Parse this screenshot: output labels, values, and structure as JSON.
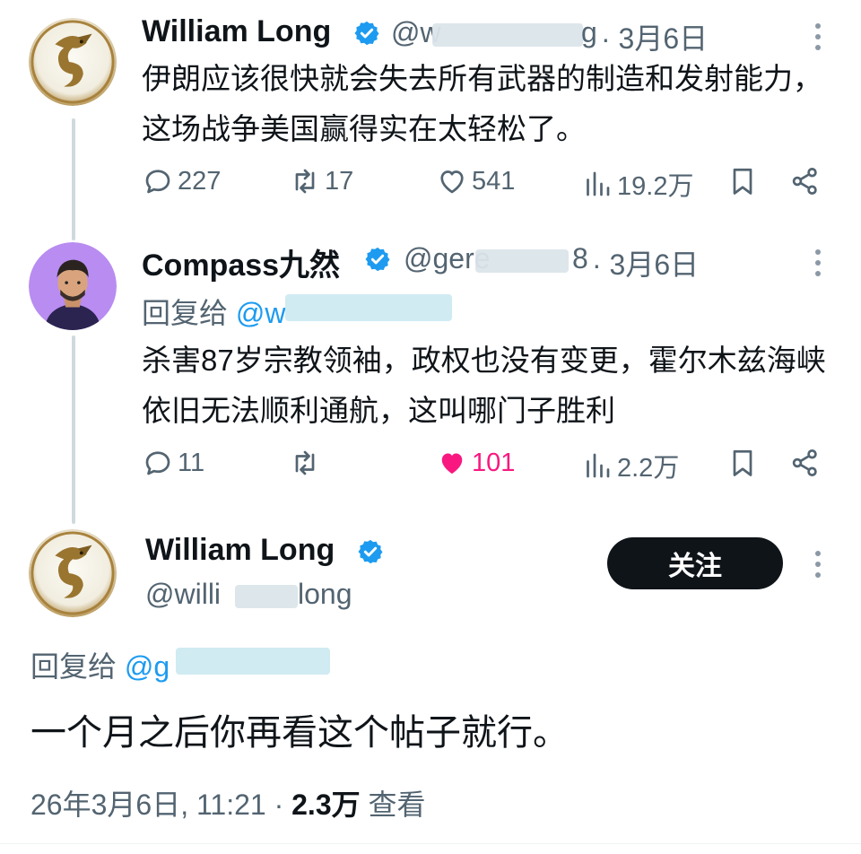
{
  "tweet1": {
    "name": "William Long",
    "handle_visible": "@w",
    "handle_tail": "g",
    "date": "· 3月6日",
    "text": "伊朗应该很快就会失去所有武器的制造和发射能力，这场战争美国赢得实在太轻松了。",
    "replies": "227",
    "retweets": "17",
    "likes": "541",
    "views": "19.2万"
  },
  "tweet2": {
    "name": "Compass九然",
    "handle_visible": "@gere",
    "handle_tail": "8",
    "date": "· 3月6日",
    "reply_prefix": "回复给",
    "reply_handle": "@w",
    "text": "杀害87岁宗教领袖，政权也没有变更，霍尔木兹海峡依旧无法顺利通航，这叫哪门子胜利",
    "replies": "11",
    "retweets": "",
    "likes": "101",
    "views": "2.2万"
  },
  "tweet3": {
    "name": "William Long",
    "handle_visible": "@willi",
    "handle_tail": "long",
    "follow_label": "关注",
    "reply_prefix": "回复给",
    "reply_handle": "@g",
    "text": "一个月之后你再看这个帖子就行。",
    "timestamp": "26年3月6日, 11:21 · ",
    "views": "2.3万",
    "views_label": " 查看"
  },
  "colors": {
    "accent": "#1d9bf0",
    "like": "#f91880",
    "secondary_text": "#536471",
    "primary_text": "#0f1419"
  }
}
